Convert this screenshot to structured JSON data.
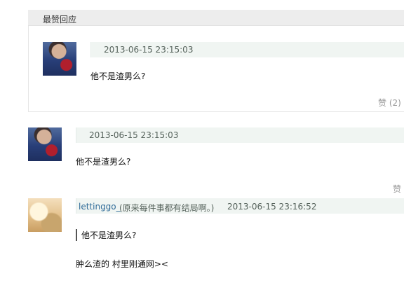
{
  "best": {
    "title": "最赞回应",
    "item": {
      "time": "2013-06-15 23:15:03",
      "text": "他不是渣男么?",
      "likes": "赞 (2)"
    }
  },
  "comments": [
    {
      "time": "2013-06-15 23:15:03",
      "text": "他不是渣男么?",
      "like": "赞"
    },
    {
      "user": "lettinggo_",
      "signature": "(原来每件事都有结局啊。)",
      "time": "2013-06-15 23:16:52",
      "quote": "他不是渣男么?",
      "text": "肿么渣的 村里刚通网><"
    }
  ]
}
